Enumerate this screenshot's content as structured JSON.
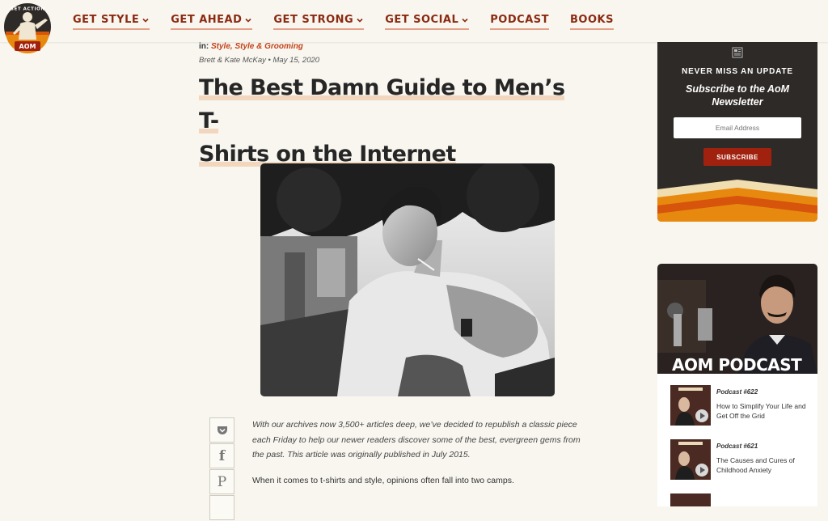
{
  "logo": {
    "top_text": "GET ACTION",
    "bottom_text": "AOM"
  },
  "nav": [
    {
      "label": "GET STYLE",
      "dropdown": true
    },
    {
      "label": "GET AHEAD",
      "dropdown": true
    },
    {
      "label": "GET STRONG",
      "dropdown": true
    },
    {
      "label": "GET SOCIAL",
      "dropdown": true
    },
    {
      "label": "PODCAST",
      "dropdown": false
    },
    {
      "label": "BOOKS",
      "dropdown": false
    }
  ],
  "article": {
    "in_label": "in:",
    "category": "Style, Style & Grooming",
    "byline": "Brett & Kate McKay • May 15, 2020",
    "title_line1": "The Best Damn Guide to Men’s T-",
    "title_line2": "Shirts on the Internet",
    "intro": "With our archives now 3,500+ articles deep, we’ve decided to republish a classic piece each Friday to help our newer readers discover some of the best, evergreen gems from the past. This article was originally published in July 2015.",
    "first_paragraph": "When it comes to t-shirts and style, opinions often fall into two camps."
  },
  "share": {
    "icons": [
      "pocket-icon",
      "facebook-icon",
      "pinterest-icon"
    ],
    "facebook_glyph": "f",
    "pinterest_glyph": "P"
  },
  "newsletter": {
    "kicker": "NEVER MISS AN UPDATE",
    "heading_line1": "Subscribe to the AoM",
    "heading_line2": "Newsletter",
    "email_placeholder": "Email Address",
    "button": "SUBSCRIBE"
  },
  "podcast": {
    "title": "AOM PODCAST",
    "episodes": [
      {
        "number": "Podcast #622",
        "title": "How to Simplify Your Life and Get Off the Grid"
      },
      {
        "number": "Podcast #621",
        "title": "The Causes and Cures of Childhood Anxiety"
      }
    ]
  },
  "colors": {
    "accent": "#8b2a12",
    "category": "#c4431a",
    "subscribe": "#a1210f",
    "panel": "#2e2a27",
    "background": "#f8f6ef",
    "stripe_cream": "#f0ddb0",
    "stripe_orange": "#e8890f",
    "stripe_dark_orange": "#d6540c"
  }
}
